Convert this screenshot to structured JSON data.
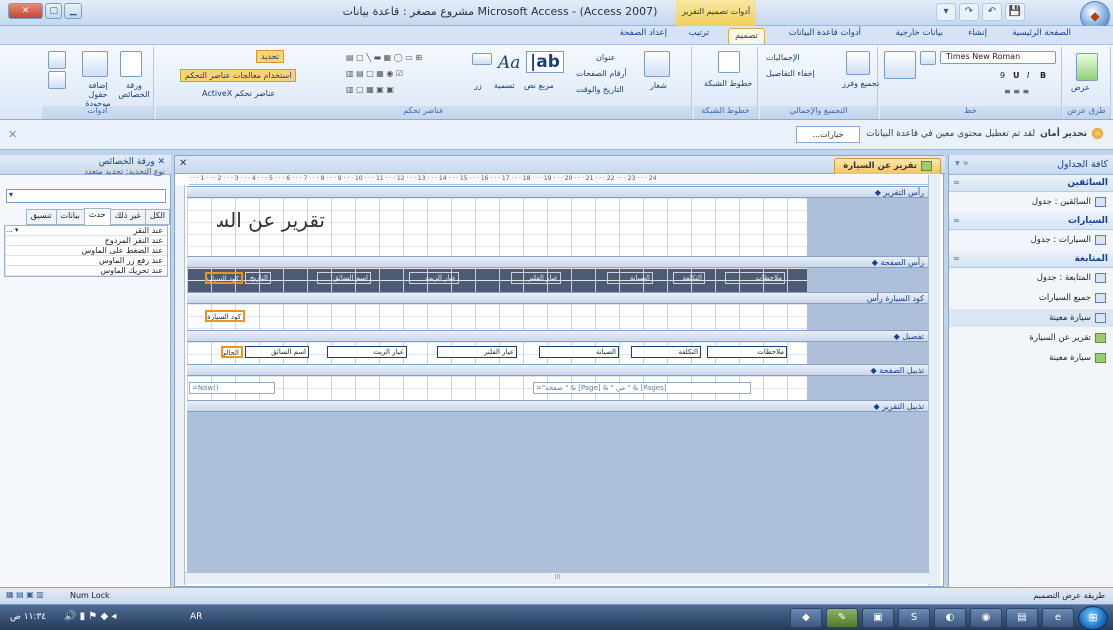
{
  "window": {
    "title": "Microsoft Access - (Access 2007) مشروع مصغر : قاعدة بيانات",
    "context_tools": "أدوات تصميم التقرير",
    "close_glyph": "✕",
    "max_glyph": "▢",
    "min_glyph": "▁"
  },
  "qat": {
    "save": "💾",
    "undo": "↶",
    "redo": "↷",
    "more": "▾"
  },
  "tabs": {
    "home": "الصفحة الرئيسية",
    "create": "إنشاء",
    "external": "بيانات خارجية",
    "dbtools": "أدوات قاعدة البيانات",
    "design": "تصميم",
    "arrange": "ترتيب",
    "pagesetup": "إعداد الصفحة"
  },
  "ribbon": {
    "views": {
      "label": "طرق عرض",
      "btn": "عرض"
    },
    "font": {
      "label": "خط",
      "name": "Times New Roman",
      "size": "9",
      "b": "B",
      "i": "I",
      "u": "U"
    },
    "grouping": {
      "label": "التجميع والإجمالي",
      "group_sort": "تجميع وفرز",
      "totals": "الإجماليات",
      "hide_details": "إخفاء التفاصيل"
    },
    "gridlines": {
      "label": "خطوط الشبكة",
      "btn": "خطوط الشبكة"
    },
    "controls": {
      "label": "عناصر تحكم",
      "logo": "شعار",
      "title": "عنوان",
      "page_numbers": "أرقام الصفحات",
      "date_time": "التاريخ والوقت",
      "textbox": "مربع نص",
      "label_ctl": "تسمية",
      "button": "زر",
      "select": "تحديد",
      "use_wizards": "استخدام معالجات عناصر التحكم",
      "activex": "عناصر تحكم ActiveX"
    },
    "tools": {
      "label": "أدوات",
      "add_fields": "إضافة حقول موجودة",
      "property_sheet": "ورقة الخصائص"
    }
  },
  "security": {
    "title": "تحذير أمان",
    "message": "لقد تم تعطيل محتوى معين في قاعدة البيانات",
    "options": "خيارات..."
  },
  "nav": {
    "header": "كافة الجداول",
    "cats": [
      {
        "name": "السائقين",
        "items": [
          {
            "label": "السائقين : جدول",
            "kind": "table"
          }
        ]
      },
      {
        "name": "السيارات",
        "items": [
          {
            "label": "السيارات : جدول",
            "kind": "table"
          }
        ]
      },
      {
        "name": "المتابعة",
        "items": [
          {
            "label": "المتابعة : جدول",
            "kind": "table"
          },
          {
            "label": "جميع السيارات",
            "kind": "query"
          },
          {
            "label": "سيارة معينة",
            "kind": "query",
            "selected": true
          },
          {
            "label": "تقرير عن السيارة",
            "kind": "report"
          },
          {
            "label": "سيارة معينة",
            "kind": "report"
          }
        ]
      }
    ]
  },
  "doc": {
    "tab": "تقرير عن السيارة"
  },
  "ruler": "· · · 1 · · · 2 · · · 3 · · · 4 · · · 5 · · · 6 · · · 7 · · · 8 · · · 9 · · · 10 · · · 11 · · · 12 · · · 13 · · · 14 · · · 15 · · · 16 · · · 17 · · · 18 · · · 19 · · · 20 · · · 21 · · · 22 · · · 23 · · · 24",
  "bands": {
    "report_header": "رأس التقرير",
    "page_header": "رأس الصفحة",
    "group_header": "كود السيارة رأس",
    "detail": "تفصيل",
    "page_footer": "تذييل الصفحة",
    "report_footer": "تذييل التقرير"
  },
  "report_title": "تقرير عن السيارة",
  "page_header_labels": [
    "كود السيارة",
    "التاريخ",
    "اسم السائق",
    "عيار الزيت",
    "عيار الفلتر",
    "الصيانة",
    "التكلفة",
    "ملاحظات"
  ],
  "group_field": "كود السيارة",
  "detail_fields": [
    "الحالي",
    "اسم السائق",
    "عيار الزيت",
    "عيار الفلتر",
    "الصيانة",
    "التكلفة",
    "ملاحظات"
  ],
  "footer": {
    "now": "=Now()",
    "pages": "=\"صفحة \" & [Page] & \" من \" & [Pages]"
  },
  "hscroll_mark": "III",
  "props": {
    "title": "ورقة الخصائص",
    "close": "✕",
    "sel_type": "نوع التحديد: تحديد متعدد",
    "tabs": [
      "تنسيق",
      "بيانات",
      "حدث",
      "غير ذلك",
      "الكل"
    ],
    "rows": [
      "عند النقر",
      "عند النقر المزدوج",
      "عند الضغط على الماوس",
      "عند رفع زر الماوس",
      "عند تحريك الماوس"
    ],
    "row0_val": "... ▾"
  },
  "status": {
    "left": "طريقة عرض التصميم",
    "right": "Num Lock"
  },
  "taskbar": {
    "time": "١١:٣٤ ص",
    "lang": "AR"
  }
}
